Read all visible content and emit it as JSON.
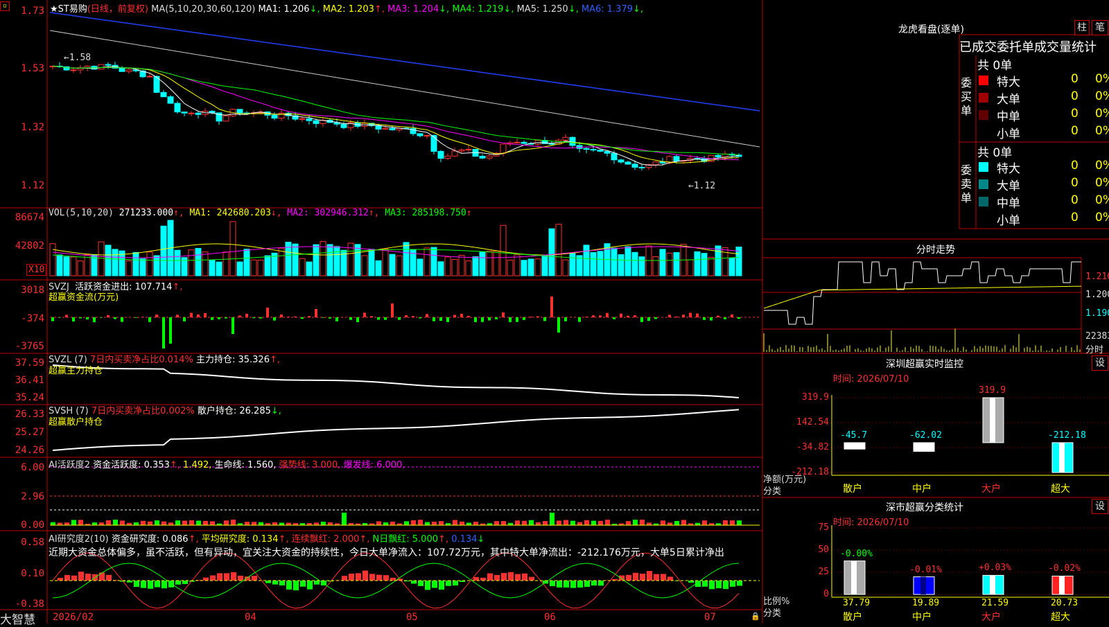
{
  "app": {
    "name": "大智慧"
  },
  "kline": {
    "stock": "★ST易购",
    "period": "(日线，前复权)",
    "ma_label": "MA(5,10,20,30,60,120)",
    "ma_values": [
      {
        "label": "MA1: 1.206",
        "arrow": "↓",
        "color": "#ffffff"
      },
      {
        "label": "MA2: 1.203",
        "arrow": "↑",
        "color": "#ffff00"
      },
      {
        "label": "MA3: 1.204",
        "arrow": "↓",
        "color": "#ff00ff"
      },
      {
        "label": "MA4: 1.219",
        "arrow": "↓",
        "color": "#00ff00"
      },
      {
        "label": "MA5: 1.250",
        "arrow": "↓",
        "color": "#dddddd"
      },
      {
        "label": "MA6: 1.379",
        "arrow": "↓",
        "color": "#3060ff"
      }
    ],
    "y_ticks": [
      "1.73",
      "1.53",
      "1.32",
      "1.12"
    ],
    "high_mark": "1.58",
    "low_mark": "1.12"
  },
  "volume": {
    "title": "VOL(5,10,20)",
    "value": "271233.000",
    "ma1": "MA1: 242680.203",
    "ma2": "MA2: 302946.312",
    "ma3": "MA3: 285198.750",
    "y_ticks": [
      "86674",
      "42802"
    ],
    "unit": "X10"
  },
  "svzj": {
    "title": "SVZJ",
    "label": "活跃资金进出: 107.714",
    "subtitle": "超赢资金流(万元)",
    "y_ticks": [
      "3018",
      "-374",
      "-3765"
    ]
  },
  "svzl": {
    "title": "SVZL (7)",
    "ratio": "7日内买卖净占比0.014%",
    "hold": "主力持仓: 35.326",
    "subtitle": "超赢主力持仓",
    "y_ticks": [
      "37.59",
      "36.41",
      "35.24"
    ]
  },
  "svsh": {
    "title": "SVSH (7)",
    "ratio": "7日内买卖净占比0.002%",
    "hold": "散户持仓: 26.285",
    "subtitle": "超赢散户持仓",
    "y_ticks": [
      "26.33",
      "25.27",
      "24.26"
    ]
  },
  "ai_active": {
    "title": "AI活跃度2",
    "l1": "资金活跃度: 0.353",
    "l2": "1.492,",
    "l3": "生命线: 1.560,",
    "l4": "强势线: 3.000,",
    "l5": "爆发线: 6.000,",
    "y_ticks": [
      "6.00",
      "2.96",
      "0.00"
    ]
  },
  "ai_research": {
    "title": "AI研究度2(10)",
    "l1": "资金研究度: 0.086",
    "l2": "平均研究度: 0.134",
    "l3": "连续飘红: 2.000",
    "l4": "N日飘红: 5.000",
    "l5": "0.134",
    "comment": "近期大资金总体偏多，虽不活跃，但有异动，宜关注大资金的持续性，今日大单净流入：107.72万元，其中特大单净流出：-212.176万元，大单5日累计净出",
    "y_ticks": [
      "0.58",
      "0.10",
      "-0.38"
    ]
  },
  "x_axis": [
    "2026/02",
    "04",
    "05",
    "06",
    "07"
  ],
  "dragon": {
    "title": "龙虎看盘(逐单)",
    "btn1": "柱",
    "btn2": "笔",
    "header": "已成交委托单成交量统计",
    "buy_label": "委买单",
    "sell_label": "委卖单",
    "buy_total": "共 0单",
    "sell_total": "共 0单",
    "buy_rows": [
      {
        "name": "特大",
        "count": "0",
        "pct": "0%",
        "color": "#ff0000"
      },
      {
        "name": "大单",
        "count": "0",
        "pct": "0%",
        "color": "#a00000"
      },
      {
        "name": "中单",
        "count": "0",
        "pct": "0%",
        "color": "#600000"
      },
      {
        "name": "小单",
        "count": "0",
        "pct": "0%",
        "color": ""
      }
    ],
    "sell_rows": [
      {
        "name": "特大",
        "count": "0",
        "pct": "0%",
        "color": "#00ffff"
      },
      {
        "name": "大单",
        "count": "0",
        "pct": "0%",
        "color": "#008888"
      },
      {
        "name": "中单",
        "count": "0",
        "pct": "0%",
        "color": "#006868"
      },
      {
        "name": "小单",
        "count": "0",
        "pct": "0%",
        "color": ""
      }
    ]
  },
  "intraday": {
    "title": "分时走势",
    "prices": [
      "1.210",
      "1.200",
      "1.190"
    ],
    "vol": "22383",
    "vol_label": "分时"
  },
  "sz_monitor": {
    "title": "深圳超赢实时监控",
    "btn": "设",
    "time": "时间: 2026/07/10",
    "y_ticks": [
      "319.9",
      "142.54",
      "-34.82",
      "-212.18"
    ],
    "unit_label": "净额(万元)",
    "cat_label": "分类",
    "chart_data": {
      "type": "bar",
      "categories": [
        "散户",
        "中户",
        "大户",
        "超大"
      ],
      "values": [
        -45.7,
        -62.02,
        319.9,
        -212.18
      ],
      "value_labels": [
        "-45.7",
        "-62.02",
        "319.9",
        "-212.18"
      ],
      "ylim": [
        -212.18,
        319.9
      ]
    }
  },
  "sz_stats": {
    "title": "深市超赢分类统计",
    "btn": "设",
    "time": "时间: 2026/07/10",
    "y_ticks": [
      "75",
      "50",
      "25",
      "0"
    ],
    "unit_label": "比例%",
    "cat_label": "分类",
    "chart_data": {
      "type": "bar",
      "categories": [
        "散户",
        "中户",
        "大户",
        "超大"
      ],
      "values": [
        37.79,
        19.89,
        21.59,
        20.73
      ],
      "value_labels": [
        "37.79",
        "19.89",
        "21.59",
        "20.73"
      ],
      "change_labels": [
        "-0.00%",
        "-0.01%",
        "+0.03%",
        "-0.02%"
      ],
      "ylim": [
        0,
        75
      ]
    }
  }
}
